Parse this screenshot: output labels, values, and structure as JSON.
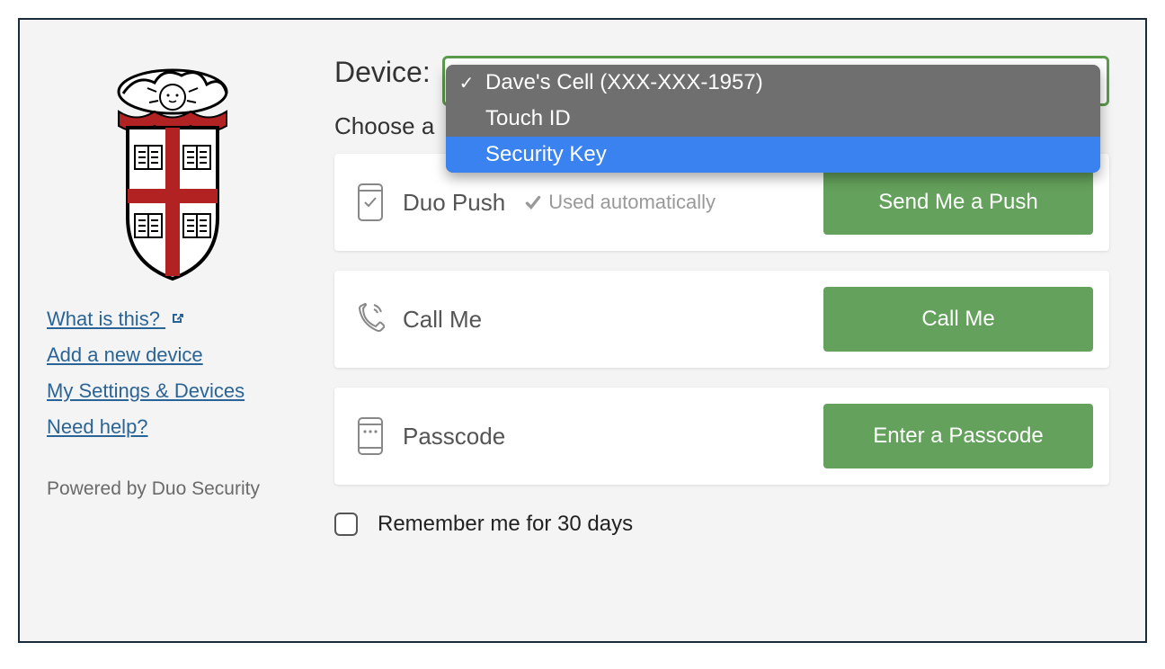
{
  "sidebar": {
    "links": {
      "what_is_this": "What is this?",
      "add_device": "Add a new device",
      "settings": "My Settings & Devices",
      "help": "Need help?"
    },
    "powered": "Powered by Duo Security"
  },
  "main": {
    "device_label": "Device:",
    "choose_label": "Choose a",
    "dropdown": {
      "options": [
        "Dave's Cell (XXX-XXX-1957)",
        "Touch ID",
        "Security Key"
      ],
      "selected_index": 0,
      "highlighted_index": 2
    },
    "auth_methods": [
      {
        "label": "Duo Push",
        "used_auto": "Used automatically",
        "button": "Send Me a Push"
      },
      {
        "label": "Call Me",
        "button": "Call Me"
      },
      {
        "label": "Passcode",
        "button": "Enter a Passcode"
      }
    ],
    "remember_label": "Remember me for 30 days"
  }
}
